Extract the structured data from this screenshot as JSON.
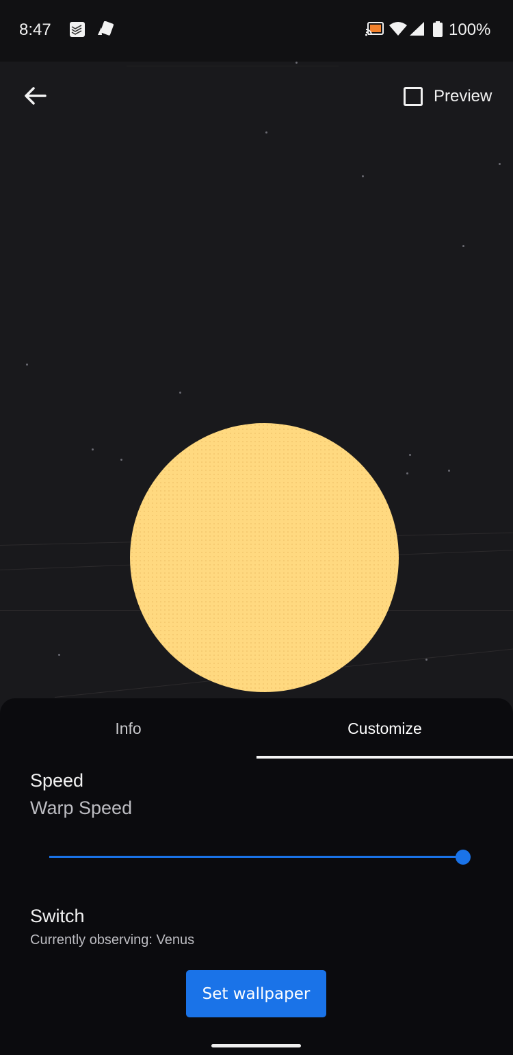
{
  "status_bar": {
    "time": "8:47",
    "notification_icons": [
      "todoist-icon",
      "cards-icon"
    ],
    "system_icons": [
      "cast-icon",
      "wifi-icon",
      "signal-icon",
      "battery-icon"
    ],
    "battery_percent": "100%"
  },
  "top_bar": {
    "back_icon": "arrow-left-icon",
    "preview_label": "Preview",
    "preview_checked": false
  },
  "wallpaper": {
    "planet": "Venus",
    "planet_color": "#FFD980"
  },
  "sheet": {
    "tabs": [
      {
        "label": "Info",
        "selected": false
      },
      {
        "label": "Customize",
        "selected": true
      }
    ],
    "speed": {
      "title": "Speed",
      "value": "Warp Speed",
      "slider_fraction": 1.0
    },
    "switch": {
      "title": "Switch",
      "subtitle": "Currently observing: Venus"
    },
    "set_wallpaper_label": "Set wallpaper"
  },
  "colors": {
    "accent": "#1A73E8",
    "sheet_bg": "#0B0B0E",
    "space_bg": "#19191C",
    "cast_active": "#F2812C"
  }
}
